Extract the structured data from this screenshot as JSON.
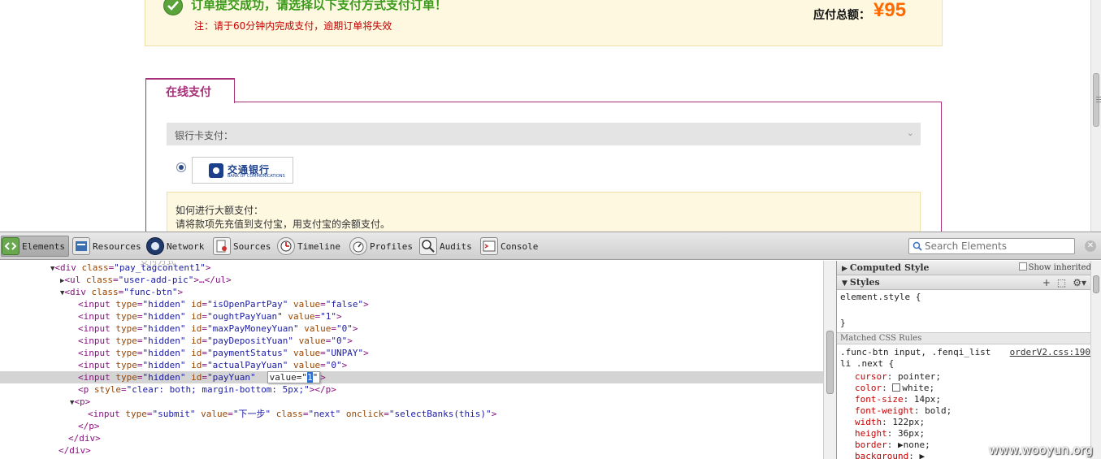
{
  "order": {
    "title": "订单提交成功，请选择以下支付方式支付订单！",
    "note": "注：请于60分钟内完成支付，逾期订单将失效",
    "due_label": "应付总额：",
    "due_amount": "¥95",
    "success_color": "#3a9a1a",
    "amount_color": "#ff6a00"
  },
  "payment": {
    "tab_label": "在线支付",
    "bank_section_label": "银行卡支付：",
    "bank_selected": true,
    "bank_logo_cn": "交通银行",
    "bank_logo_en": "BANK OF COMMUNICATIONS",
    "tips_title": "如何进行大额支付：",
    "tips_text": "请将款项先充值到支付宝，用支付宝的余额支付。",
    "accent_color": "#a8307a"
  },
  "devtools": {
    "tabs": [
      {
        "label": "Elements",
        "icon": "elements-icon",
        "active": true
      },
      {
        "label": "Resources",
        "icon": "resources-icon",
        "active": false
      },
      {
        "label": "Network",
        "icon": "network-icon",
        "active": false
      },
      {
        "label": "Sources",
        "icon": "sources-icon",
        "active": false
      },
      {
        "label": "Timeline",
        "icon": "timeline-icon",
        "active": false
      },
      {
        "label": "Profiles",
        "icon": "profiles-icon",
        "active": false
      },
      {
        "label": "Audits",
        "icon": "audits-icon",
        "active": false
      },
      {
        "label": "Console",
        "icon": "console-icon",
        "active": false
      }
    ],
    "search_placeholder": "Search Elements"
  },
  "dom_tree": {
    "r0": {
      "open": "<div",
      "attrs": [
        [
          "class",
          "\"pay_tagcontent1\""
        ]
      ],
      "close": ">"
    },
    "r1": {
      "open": "<ul",
      "attrs": [
        [
          "class",
          "\"user-add-pic\""
        ]
      ],
      "mid": ">…",
      "close": "</ul>"
    },
    "r2": {
      "open": "<div",
      "attrs": [
        [
          "class",
          "\"func-btn\""
        ]
      ],
      "close": ">"
    },
    "inputs": [
      {
        "id": "\"isOpenPartPay\"",
        "value": "\"false\""
      },
      {
        "id": "\"oughtPayYuan\"",
        "value": "\"1\""
      },
      {
        "id": "\"maxPayMoneyYuan\"",
        "value": "\"0\""
      },
      {
        "id": "\"payDepositYuan\"",
        "value": "\"0\""
      },
      {
        "id": "\"paymentStatus\"",
        "value": "\"UNPAY\""
      },
      {
        "id": "\"actualPayYuan\"",
        "value": "\"0\""
      }
    ],
    "input_tag": "<input",
    "type_attr": "type",
    "type_val": "\"hidden\"",
    "id_attr": "id",
    "value_attr": "value",
    "tag_close": ">",
    "selected": {
      "id": "\"payYuan\"",
      "edit_prefix": "value=\"",
      "edit_selected": "1",
      "edit_suffix": "\"",
      "end": ">"
    },
    "p_style": {
      "open": "<p",
      "attr": "style",
      "val": "\"clear: both; margin-bottom: 5px;\"",
      "end": "></p>"
    },
    "p_open": "<p>",
    "submit": {
      "open": "<input",
      "type_val": "\"submit\"",
      "value_val": "\"下一步\"",
      "class_attr": "class",
      "class_val": "\"next\"",
      "onclick_attr": "onclick",
      "onclick_val": "\"selectBanks(this)\"",
      "end": ">"
    },
    "p_close": "</p>",
    "div_close_inner": "</div>",
    "div_close_outer": "</div>",
    "cut_text": "支付方式"
  },
  "styles_panel": {
    "computed_header": "Computed Style",
    "show_inherited": "Show inherited",
    "styles_header": "Styles",
    "element_style_open": "element.style {",
    "element_style_close": "}",
    "matched_header": "Matched CSS Rules",
    "selector_line1": ".func-btn input, .fenqi_list",
    "selector_line2": "li .next {",
    "source_link": "orderV2.css:190",
    "properties": [
      {
        "name": "cursor",
        "value": "pointer;"
      },
      {
        "name": "color",
        "value": "white;",
        "swatch": "#ffffff"
      },
      {
        "name": "font-size",
        "value": "14px;"
      },
      {
        "name": "font-weight",
        "value": "bold;"
      },
      {
        "name": "width",
        "value": "122px;"
      },
      {
        "name": "height",
        "value": "36px;"
      },
      {
        "name": "border",
        "value": "▶none;"
      },
      {
        "name": "background",
        "value": "▶"
      }
    ]
  },
  "watermark": "www.wooyun.org"
}
